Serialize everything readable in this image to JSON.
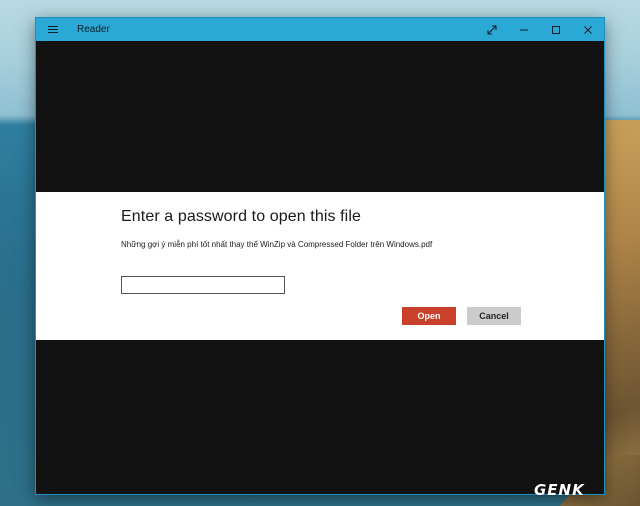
{
  "window": {
    "title": "Reader",
    "menu_icon": "hamburger-icon",
    "controls": {
      "fullscreen_icon": "expand-icon",
      "minimize_icon": "minimize-icon",
      "maximize_icon": "maximize-icon",
      "close_icon": "close-icon"
    }
  },
  "dialog": {
    "heading": "Enter a password to open this file",
    "filename": "Những gợi ý miễn phí tốt nhất thay thế WinZip và Compressed Folder trên Windows.pdf",
    "password_value": "",
    "open_label": "Open",
    "cancel_label": "Cancel"
  },
  "colors": {
    "titlebar": "#2ba9d6",
    "open_button": "#c9412b",
    "cancel_button": "#cccccc"
  },
  "watermark": "GENK"
}
